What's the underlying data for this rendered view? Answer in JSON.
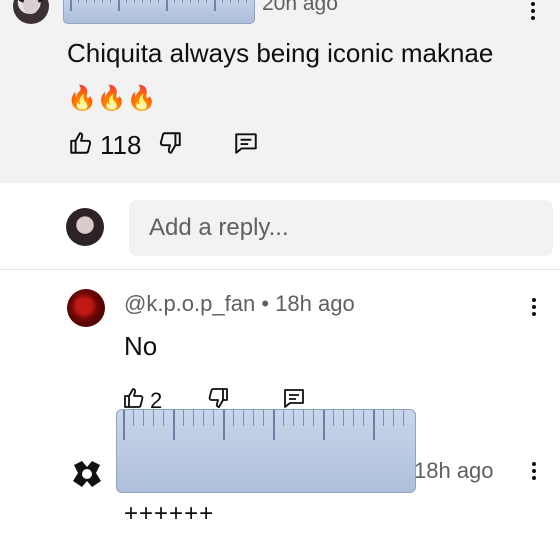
{
  "thread_top": {
    "timestamp": "20h ago",
    "text": "Chiquita always being iconic maknae",
    "emoji": "🔥🔥🔥",
    "like_count": "118"
  },
  "reply_box": {
    "placeholder": "Add a reply..."
  },
  "reply_1": {
    "handle": "@k.p.o.p_fan",
    "separator": "•",
    "timestamp": "18h ago",
    "text": "No",
    "like_count": "2"
  },
  "reply_2": {
    "timestamp": "18h ago",
    "text": "++++++"
  },
  "icons": {
    "like": "thumbs-up-icon",
    "dislike": "thumbs-down-icon",
    "reply": "comment-icon",
    "more": "more-vert-icon"
  },
  "colors": {
    "top_bg": "#f2f2f2",
    "fire": "#ff5a1f",
    "secondary_text": "#606060"
  }
}
